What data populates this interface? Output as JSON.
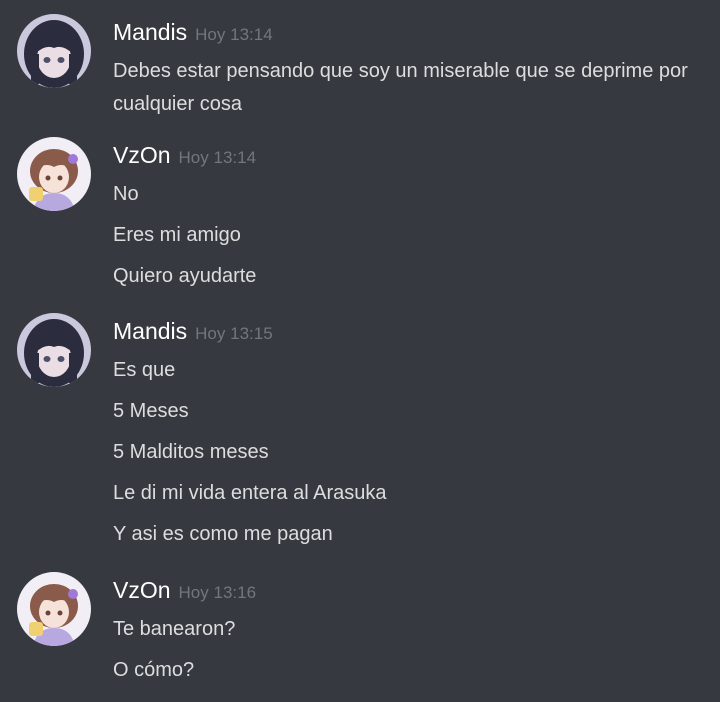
{
  "messages": [
    {
      "author": "Mandis",
      "time": "Hoy 13:14",
      "avatar": "mandis-avatar",
      "lines": [
        "Debes estar pensando que soy un miserable que se deprime por cualquier cosa"
      ]
    },
    {
      "author": "VzOn",
      "time": "Hoy 13:14",
      "avatar": "vzon-avatar",
      "lines": [
        "No",
        "Eres mi amigo",
        "Quiero ayudarte"
      ]
    },
    {
      "author": "Mandis",
      "time": "Hoy 13:15",
      "avatar": "mandis-avatar",
      "lines": [
        "Es que",
        "5 Meses",
        "5 Malditos meses",
        "Le di mi vida entera al Arasuka",
        "Y asi es como me pagan"
      ]
    },
    {
      "author": "VzOn",
      "time": "Hoy 13:16",
      "avatar": "vzon-avatar",
      "lines": [
        "Te banearon?",
        "O cómo?"
      ]
    }
  ],
  "colors": {
    "background": "#36393f",
    "username": "#ffffff",
    "timestamp": "#72767d",
    "text": "#dcddde"
  }
}
